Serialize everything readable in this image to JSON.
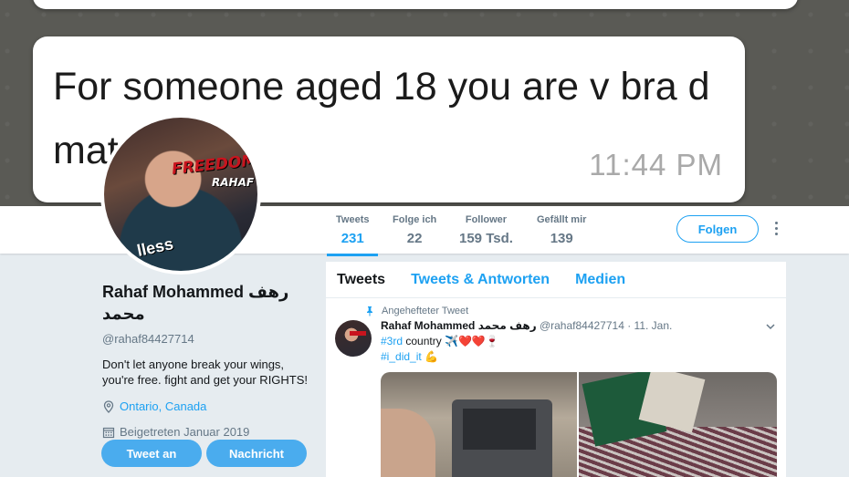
{
  "banner": {
    "top_time": "11:44 PM",
    "message_text": "For someone aged 18 you are v bra   d mature.",
    "message_time": "11:44 PM"
  },
  "nav": {
    "stats": [
      {
        "label": "Tweets",
        "value": "231"
      },
      {
        "label": "Folge ich",
        "value": "22"
      },
      {
        "label": "Follower",
        "value": "159 Tsd."
      },
      {
        "label": "Gefällt mir",
        "value": "139"
      }
    ],
    "follow_label": "Folgen"
  },
  "avatar": {
    "freedom_text": "FREEDOM",
    "rahaf_text": "RAHAF",
    "shirt_text": "lless"
  },
  "profile": {
    "name": "Rahaf Mohammed رهف محمد",
    "handle": "@rahaf84427714",
    "bio": "Don't let anyone break your wings, you're free. fight and get your RIGHTS!",
    "location": "Ontario, Canada",
    "joined": "Beigetreten Januar 2019",
    "tweet_to_label": "Tweet an",
    "message_label": "Nachricht"
  },
  "timeline": {
    "tabs": [
      "Tweets",
      "Tweets & Antworten",
      "Medien"
    ],
    "pinned_label": "Angehefteter Tweet",
    "tweet": {
      "name": "Rahaf Mohammed رهف محمد",
      "handle_date": "@rahaf84427714 · 11. Jan.",
      "hashtag1": "#3rd",
      "line1_rest": " country ✈️❤️❤️🍷",
      "hashtag2": "#i_did_it",
      "line2_rest": " 💪"
    }
  },
  "colors": {
    "accent": "#1da1f2",
    "button": "#4aacee",
    "page_bg": "#e6ecf0"
  }
}
